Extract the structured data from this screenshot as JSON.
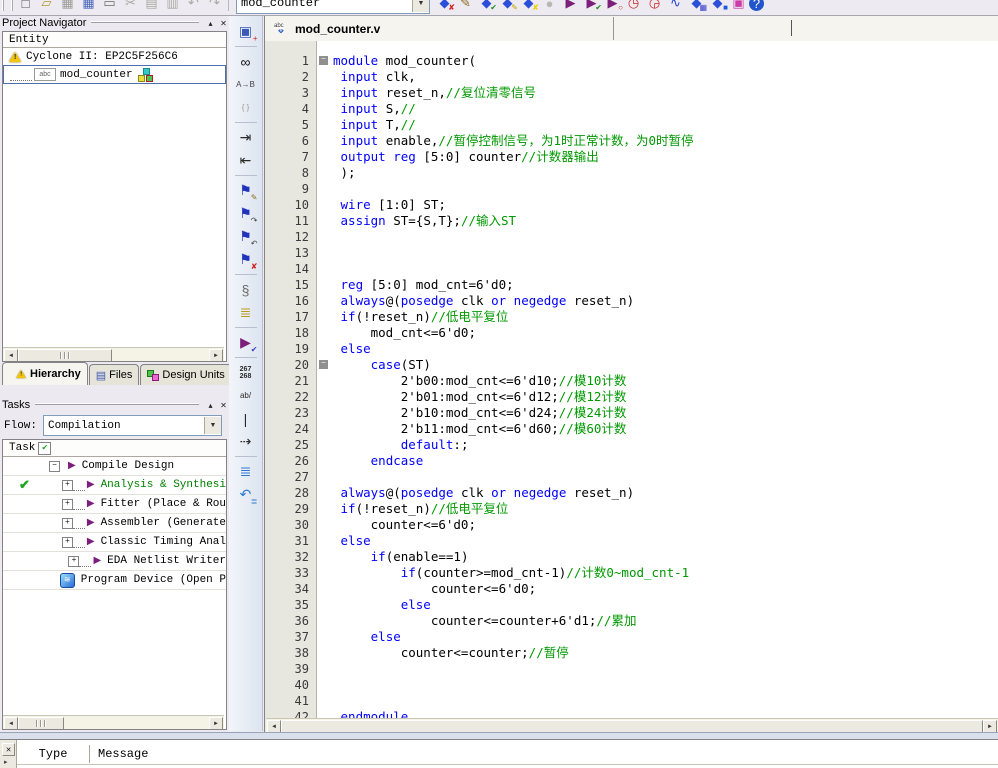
{
  "glyphs": {
    "close": "✕",
    "collapse": "▴",
    "dropdown": "▼",
    "scroll_left": "◄",
    "scroll_right": "►",
    "minus": "−",
    "plus": "+",
    "check": "✔",
    "play": "▶",
    "abc": "abc",
    "file_arrows": "⇕",
    "warning_excl": "!",
    "more_arrow": "▸"
  },
  "colors": {
    "keyword": "#0000ff",
    "comment": "#009900",
    "plain": "#000000",
    "selection_border": "#4d6fae",
    "task_done": "#1fa51f",
    "task_green": "#008000"
  },
  "toolbar": {
    "document_combo": "mod_counter",
    "left_icons": [
      {
        "name": "new-file-icon",
        "glyph": "□",
        "color": "#555555"
      },
      {
        "name": "open-file-icon",
        "glyph": "▱",
        "color": "#b39a2e"
      },
      {
        "name": "save-icon",
        "glyph": "▦",
        "color": "#9a9a94"
      },
      {
        "name": "save-all-icon",
        "glyph": "▦",
        "color": "#4a66b8"
      },
      {
        "name": "print-icon",
        "glyph": "▭",
        "color": "#6a6a66"
      },
      {
        "name": "cut-icon",
        "glyph": "✂",
        "color": "#a8a8a2"
      },
      {
        "name": "copy-icon",
        "glyph": "▤",
        "color": "#a8a8a2"
      },
      {
        "name": "paste-icon",
        "glyph": "▥",
        "color": "#a8a8a2"
      },
      {
        "name": "undo-icon",
        "glyph": "↶",
        "color": "#a8a8a2"
      },
      {
        "name": "redo-icon",
        "glyph": "↷",
        "color": "#a8a8a2"
      }
    ],
    "right_icons": [
      {
        "name": "settings-icon",
        "glyph": "◆",
        "color": "#2b4fd8",
        "overlay": "✘",
        "overlay_color": "#d42020"
      },
      {
        "name": "assignment-editor-icon",
        "glyph": "✎",
        "color": "#8a6d1f"
      },
      {
        "name": "timing-settings-icon",
        "glyph": "◆",
        "color": "#2b4fd8",
        "overlay": "✔",
        "overlay_color": "#1f8a1f"
      },
      {
        "name": "pin-planner-icon",
        "glyph": "◆",
        "color": "#2b4fd8",
        "overlay": "✎",
        "overlay_color": "#c8a200"
      },
      {
        "name": "design-assistant-icon",
        "glyph": "◆",
        "color": "#2b4fd8",
        "overlay": "✘",
        "overlay_color": "#e8d000"
      },
      {
        "name": "stop-icon",
        "glyph": "●",
        "color": "#b8b8b2"
      },
      {
        "name": "start-compilation-icon",
        "glyph": "▶",
        "color": "#7b1f7b"
      },
      {
        "name": "start-analysis-icon",
        "glyph": "▶",
        "color": "#7b1f7b",
        "overlay": "✔",
        "overlay_color": "#1f8a1f"
      },
      {
        "name": "start-timing-icon",
        "glyph": "▶",
        "color": "#7b1f7b",
        "overlay": "○",
        "overlay_color": "#cc2222"
      },
      {
        "name": "timequest-clock-icon",
        "glyph": "◷",
        "color": "#cc2222"
      },
      {
        "name": "classic-timing-clock-icon",
        "glyph": "◶",
        "color": "#cc2222"
      },
      {
        "name": "waveform-simulator-icon",
        "glyph": "∿",
        "color": "#2244cc"
      },
      {
        "name": "netlist-viewer-icon",
        "glyph": "◆",
        "color": "#2b4fd8",
        "overlay": "▦",
        "overlay_color": "#3a3ad0"
      },
      {
        "name": "technology-viewer-icon",
        "glyph": "◆",
        "color": "#2b4fd8",
        "overlay": "■",
        "overlay_color": "#2255dd"
      },
      {
        "name": "programmer-icon",
        "glyph": "▣",
        "color": "#cc3aa8"
      },
      {
        "name": "help-icon",
        "glyph": "?",
        "color": "#ffffff",
        "bg": "#2255cc"
      }
    ]
  },
  "project_navigator": {
    "title": "Project Navigator",
    "column_header": "Entity",
    "items": [
      {
        "label": "Cyclone II: EP2C5F256C6",
        "icon": "device-warning"
      },
      {
        "label": "mod_counter",
        "icon": "abc-entity",
        "selected": true
      }
    ],
    "tabs": [
      {
        "label": "Hierarchy"
      },
      {
        "label": "Files"
      },
      {
        "label": "Design Units"
      }
    ]
  },
  "tasks": {
    "title": "Tasks",
    "flow_label": "Flow:",
    "flow_value": "Compilation",
    "column_header": "Task",
    "rows": [
      {
        "kind": "parent",
        "label": "Compile Design"
      },
      {
        "kind": "child",
        "label": "Analysis & Synthesi",
        "done": true,
        "green": true
      },
      {
        "kind": "child",
        "label": "Fitter (Place & Rou"
      },
      {
        "kind": "child",
        "label": "Assembler (Generate"
      },
      {
        "kind": "child",
        "label": "Classic Timing Anal"
      },
      {
        "kind": "child",
        "label": "EDA Netlist Writer"
      },
      {
        "kind": "device",
        "label": "Program Device (Open P"
      }
    ]
  },
  "vtoolbar": [
    {
      "name": "new-document-window-icon",
      "glyph": "▣",
      "color": "#3a5ab8",
      "overlay": "+",
      "overlay_color": "#d42020"
    },
    {
      "sep": true
    },
    {
      "name": "find-icon",
      "glyph": "∞",
      "color": "#111111"
    },
    {
      "name": "replace-icon",
      "glyph": "A→B",
      "color": "#444444",
      "small": true
    },
    {
      "name": "matching-brace-icon",
      "glyph": "{ }",
      "color": "#9a9a94",
      "small": true
    },
    {
      "sep": true
    },
    {
      "name": "indent-icon",
      "glyph": "⇥",
      "color": "#2a2a2a"
    },
    {
      "name": "outdent-icon",
      "glyph": "⇤",
      "color": "#2a2a2a"
    },
    {
      "sep": true
    },
    {
      "name": "toggle-bookmark-icon",
      "glyph": "⚑",
      "color": "#2233bb",
      "overlay": "✎",
      "overlay_color": "#8a6d1f"
    },
    {
      "name": "next-bookmark-icon",
      "glyph": "⚑",
      "color": "#2233bb",
      "overlay": "↷",
      "overlay_color": "#444444"
    },
    {
      "name": "previous-bookmark-icon",
      "glyph": "⚑",
      "color": "#2233bb",
      "overlay": "↶",
      "overlay_color": "#444444"
    },
    {
      "name": "clear-bookmarks-icon",
      "glyph": "⚑",
      "color": "#2233bb",
      "overlay": "✘",
      "overlay_color": "#d42020"
    },
    {
      "sep": true
    },
    {
      "name": "attach-file-icon",
      "glyph": "§",
      "color": "#6a6a66"
    },
    {
      "name": "insert-template-icon",
      "glyph": "≣",
      "color": "#b89a20"
    },
    {
      "sep": true
    },
    {
      "name": "analyze-current-file-icon",
      "glyph": "▶",
      "color": "#7b1f7b",
      "overlay": "✔",
      "overlay_color": "#3a3ad0"
    },
    {
      "sep": true
    },
    {
      "name": "line-numbers-icon",
      "lines": [
        "267",
        "268"
      ],
      "color": "#2a2a2a"
    },
    {
      "name": "text-case-icon",
      "glyph": "ab/",
      "color": "#2a2a2a",
      "small": true
    },
    {
      "name": "insert-bar-icon",
      "glyph": "|",
      "color": "#2a2a2a"
    },
    {
      "name": "goto-line-icon",
      "glyph": "⇢",
      "color": "#2a2a2a"
    },
    {
      "sep": true
    },
    {
      "name": "comment-selection-icon",
      "glyph": "≣",
      "color": "#2a7ad0"
    },
    {
      "name": "uncomment-selection-icon",
      "glyph": "↶",
      "color": "#2a7ad0",
      "overlay": "≣",
      "overlay_color": "#2a7ad0"
    }
  ],
  "editor": {
    "tab_title": "mod_counter.v",
    "lines": [
      {
        "fold": true,
        "s": [
          [
            "k",
            "module"
          ],
          [
            "p",
            " mod_counter("
          ]
        ]
      },
      {
        "s": [
          [
            "p",
            " "
          ],
          [
            "k",
            "input"
          ],
          [
            "p",
            " clk,"
          ]
        ]
      },
      {
        "s": [
          [
            "p",
            " "
          ],
          [
            "k",
            "input"
          ],
          [
            "p",
            " reset_n,"
          ],
          [
            "c",
            "//复位清零信号"
          ]
        ]
      },
      {
        "s": [
          [
            "p",
            " "
          ],
          [
            "k",
            "input"
          ],
          [
            "p",
            " S,"
          ],
          [
            "c",
            "//"
          ]
        ]
      },
      {
        "s": [
          [
            "p",
            " "
          ],
          [
            "k",
            "input"
          ],
          [
            "p",
            " T,"
          ],
          [
            "c",
            "//"
          ]
        ]
      },
      {
        "s": [
          [
            "p",
            " "
          ],
          [
            "k",
            "input"
          ],
          [
            "p",
            " enable,"
          ],
          [
            "c",
            "//暂停控制信号，为1时正常计数，为0时暂停"
          ]
        ]
      },
      {
        "s": [
          [
            "p",
            " "
          ],
          [
            "k",
            "output"
          ],
          [
            "p",
            " "
          ],
          [
            "k",
            "reg"
          ],
          [
            "p",
            " [5:0] counter"
          ],
          [
            "c",
            "//计数器输出"
          ]
        ]
      },
      {
        "s": [
          [
            "p",
            " );"
          ]
        ]
      },
      {
        "s": []
      },
      {
        "s": [
          [
            "p",
            " "
          ],
          [
            "k",
            "wire"
          ],
          [
            "p",
            " [1:0] ST;"
          ]
        ]
      },
      {
        "s": [
          [
            "p",
            " "
          ],
          [
            "k",
            "assign"
          ],
          [
            "p",
            " ST={S,T};"
          ],
          [
            "c",
            "//输入ST"
          ]
        ]
      },
      {
        "s": []
      },
      {
        "s": []
      },
      {
        "s": []
      },
      {
        "s": [
          [
            "p",
            " "
          ],
          [
            "k",
            "reg"
          ],
          [
            "p",
            " [5:0] mod_cnt=6'd0;"
          ]
        ]
      },
      {
        "s": [
          [
            "p",
            " "
          ],
          [
            "k",
            "always"
          ],
          [
            "p",
            "@("
          ],
          [
            "k",
            "posedge"
          ],
          [
            "p",
            " clk "
          ],
          [
            "k",
            "or"
          ],
          [
            "p",
            " "
          ],
          [
            "k",
            "negedge"
          ],
          [
            "p",
            " reset_n)"
          ]
        ]
      },
      {
        "s": [
          [
            "p",
            " "
          ],
          [
            "k",
            "if"
          ],
          [
            "p",
            "(!reset_n)"
          ],
          [
            "c",
            "//低电平复位"
          ]
        ]
      },
      {
        "s": [
          [
            "p",
            "     mod_cnt<=6'd0;"
          ]
        ]
      },
      {
        "s": [
          [
            "p",
            " "
          ],
          [
            "k",
            "else"
          ]
        ]
      },
      {
        "fold": true,
        "s": [
          [
            "p",
            "     "
          ],
          [
            "k",
            "case"
          ],
          [
            "p",
            "(ST)"
          ]
        ]
      },
      {
        "s": [
          [
            "p",
            "         2'b00:mod_cnt<=6'd10;"
          ],
          [
            "c",
            "//模10计数"
          ]
        ]
      },
      {
        "s": [
          [
            "p",
            "         2'b01:mod_cnt<=6'd12;"
          ],
          [
            "c",
            "//模12计数"
          ]
        ]
      },
      {
        "s": [
          [
            "p",
            "         2'b10:mod_cnt<=6'd24;"
          ],
          [
            "c",
            "//模24计数"
          ]
        ]
      },
      {
        "s": [
          [
            "p",
            "         2'b11:mod_cnt<=6'd60;"
          ],
          [
            "c",
            "//模60计数"
          ]
        ]
      },
      {
        "s": [
          [
            "p",
            "         "
          ],
          [
            "k",
            "default"
          ],
          [
            "p",
            ":;"
          ]
        ]
      },
      {
        "s": [
          [
            "p",
            "     "
          ],
          [
            "k",
            "endcase"
          ]
        ]
      },
      {
        "s": []
      },
      {
        "s": [
          [
            "p",
            " "
          ],
          [
            "k",
            "always"
          ],
          [
            "p",
            "@("
          ],
          [
            "k",
            "posedge"
          ],
          [
            "p",
            " clk "
          ],
          [
            "k",
            "or"
          ],
          [
            "p",
            " "
          ],
          [
            "k",
            "negedge"
          ],
          [
            "p",
            " reset_n)"
          ]
        ]
      },
      {
        "s": [
          [
            "p",
            " "
          ],
          [
            "k",
            "if"
          ],
          [
            "p",
            "(!reset_n)"
          ],
          [
            "c",
            "//低电平复位"
          ]
        ]
      },
      {
        "s": [
          [
            "p",
            "     counter<=6'd0;"
          ]
        ]
      },
      {
        "s": [
          [
            "p",
            " "
          ],
          [
            "k",
            "else"
          ]
        ]
      },
      {
        "s": [
          [
            "p",
            "     "
          ],
          [
            "k",
            "if"
          ],
          [
            "p",
            "(enable==1)"
          ]
        ]
      },
      {
        "s": [
          [
            "p",
            "         "
          ],
          [
            "k",
            "if"
          ],
          [
            "p",
            "(counter>=mod_cnt-1)"
          ],
          [
            "c",
            "//计数0~mod_cnt-1"
          ]
        ]
      },
      {
        "s": [
          [
            "p",
            "             counter<=6'd0;"
          ]
        ]
      },
      {
        "s": [
          [
            "p",
            "         "
          ],
          [
            "k",
            "else"
          ]
        ]
      },
      {
        "s": [
          [
            "p",
            "             counter<=counter+6'd1;"
          ],
          [
            "c",
            "//累加"
          ]
        ]
      },
      {
        "s": [
          [
            "p",
            "     "
          ],
          [
            "k",
            "else"
          ]
        ]
      },
      {
        "s": [
          [
            "p",
            "         counter<=counter;"
          ],
          [
            "c",
            "//暂停"
          ]
        ]
      },
      {
        "s": []
      },
      {
        "s": []
      },
      {
        "s": []
      },
      {
        "s": [
          [
            "p",
            " "
          ],
          [
            "k",
            "endmodule"
          ]
        ]
      }
    ]
  },
  "messages": {
    "columns": [
      "Type",
      "Message"
    ]
  }
}
